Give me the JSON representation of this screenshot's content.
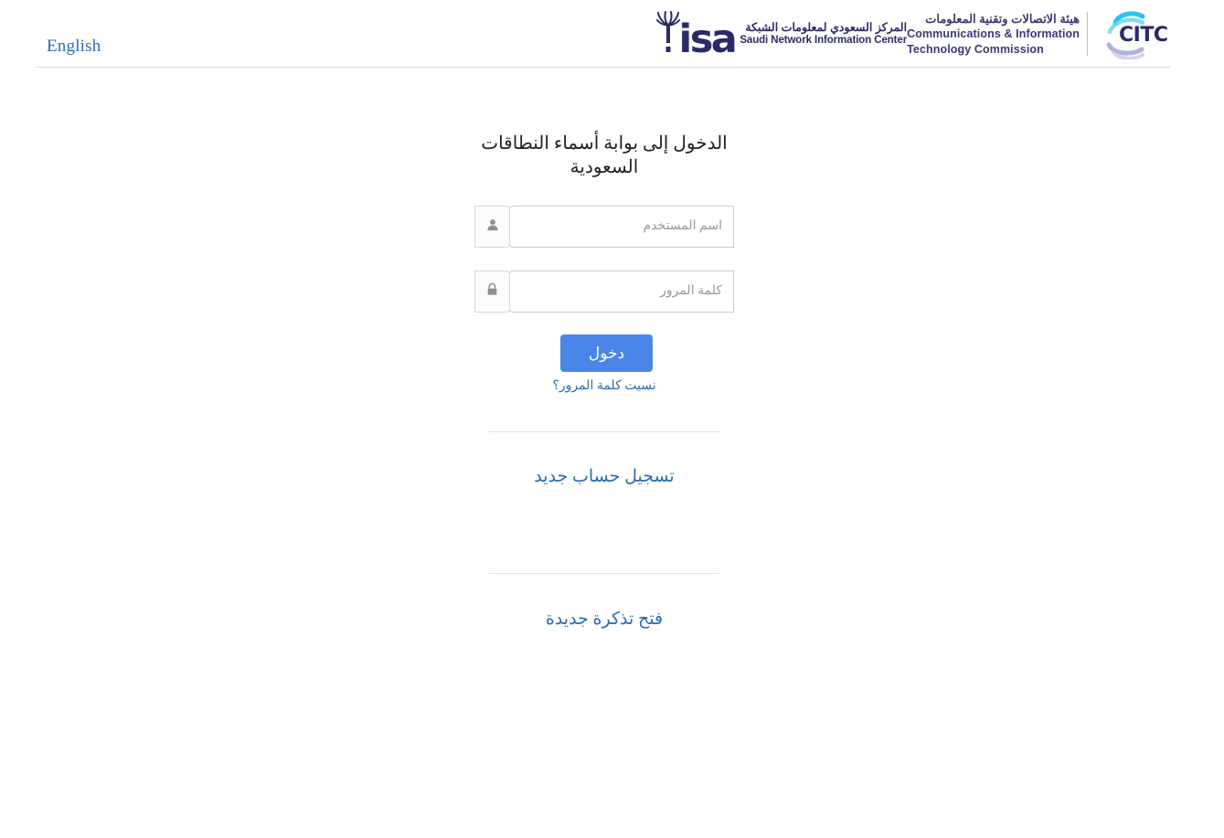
{
  "header": {
    "language_switch_label": "English",
    "snic": {
      "arabic": "المركز السعودي لمعلومات الشبكة",
      "english": "Saudi Network Information Center",
      "wordmark": "isa"
    },
    "citc": {
      "wordmark": "CITC",
      "arabic": "هيئة الاتصالات وتقنية المعلومات",
      "english_line1": "Communications & Information",
      "english_line2": "Technology Commission"
    }
  },
  "login": {
    "title": "الدخول إلى بوابة أسماء النطاقات السعودية",
    "username": {
      "value": "",
      "placeholder": "اسم المستخدم",
      "icon": "user-icon"
    },
    "password": {
      "value": "",
      "placeholder": "كلمة المرور",
      "icon": "lock-icon"
    },
    "submit_label": "دخول",
    "forgot_password_label": "نسيت كلمة المرور؟",
    "register_label": "تسجيل حساب جديد",
    "new_ticket_label": "فتح تذكرة جديدة"
  },
  "colors": {
    "primary_button": "#4a86e8",
    "link": "#2b6cb0",
    "brand_navy": "#2b2a68",
    "brand_purple": "#3b3a76",
    "border": "#cccccc",
    "placeholder": "#9a9a9a"
  }
}
